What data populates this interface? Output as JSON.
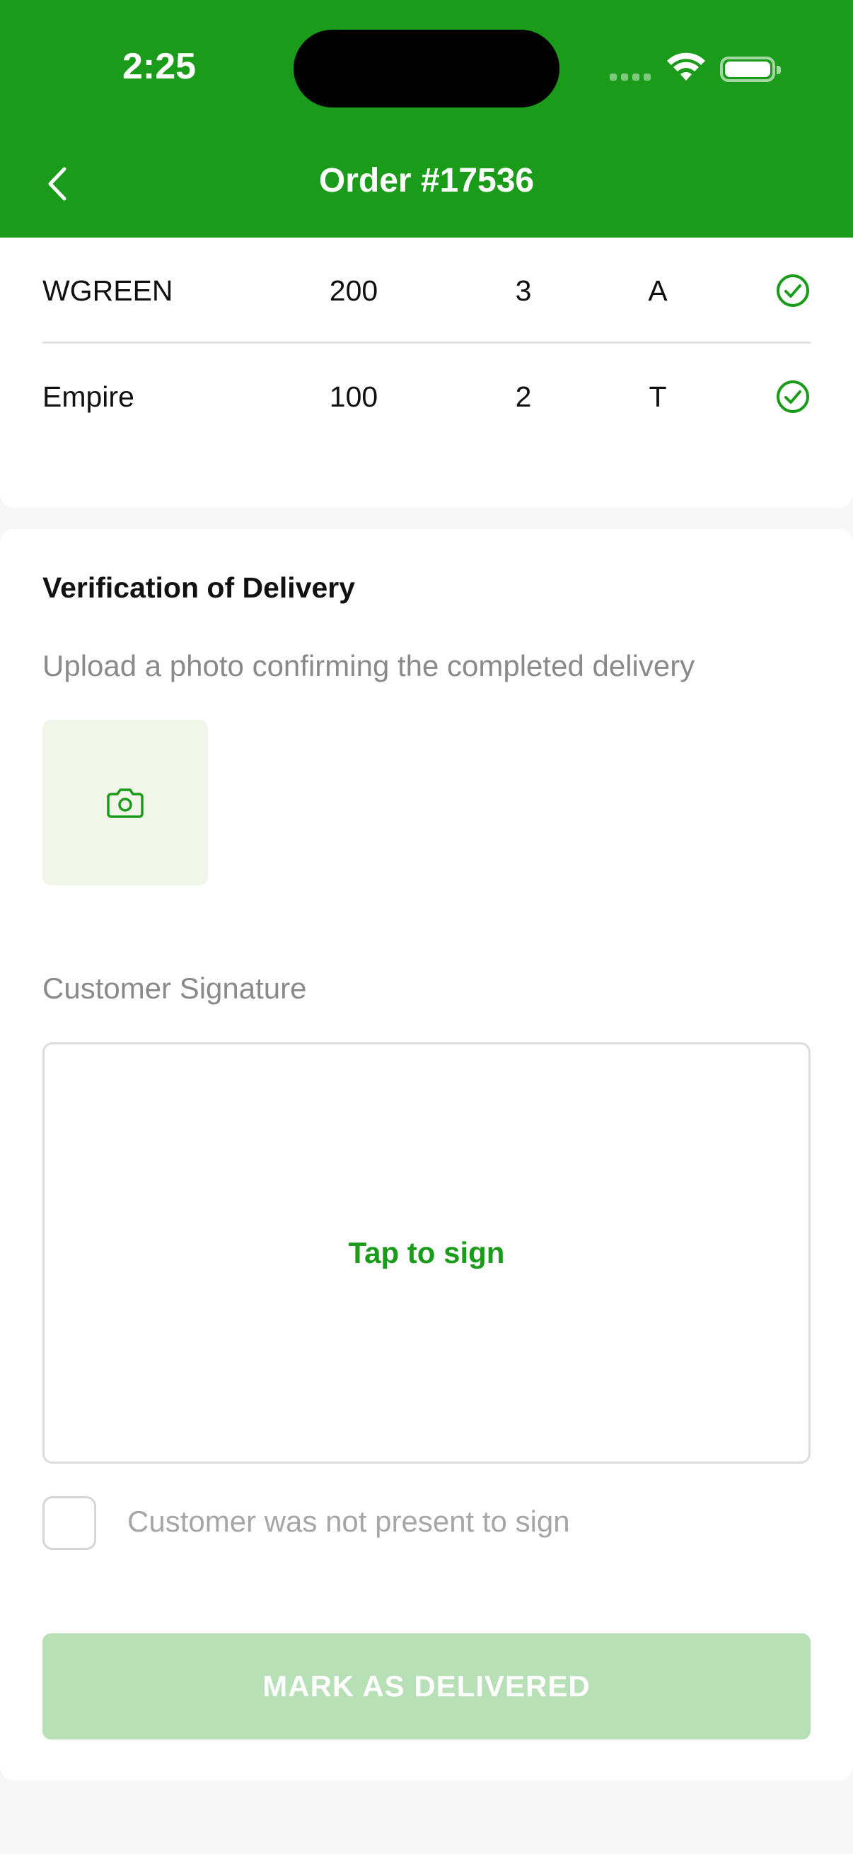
{
  "status_bar": {
    "time": "2:25"
  },
  "nav": {
    "title": "Order #17536"
  },
  "items": [
    {
      "name": "WGREEN",
      "qty": "200",
      "count": "3",
      "code": "A",
      "verified": true
    },
    {
      "name": "Empire",
      "qty": "100",
      "count": "2",
      "code": "T",
      "verified": true
    }
  ],
  "verification": {
    "title": "Verification of Delivery",
    "subtitle": "Upload a photo confirming the completed delivery",
    "signature_label": "Customer Signature",
    "signature_hint": "Tap to sign",
    "not_present_label": "Customer was not present to sign",
    "not_present_checked": false,
    "submit_label": "MARK AS DELIVERED"
  },
  "colors": {
    "brand_green": "#1a9c1a",
    "disabled_button": "#b7e0b7",
    "photo_tile_bg": "#f2f6e9"
  },
  "icons": {
    "back": "chevron-left-icon",
    "photo": "camera-icon",
    "verified": "check-circle-icon"
  }
}
